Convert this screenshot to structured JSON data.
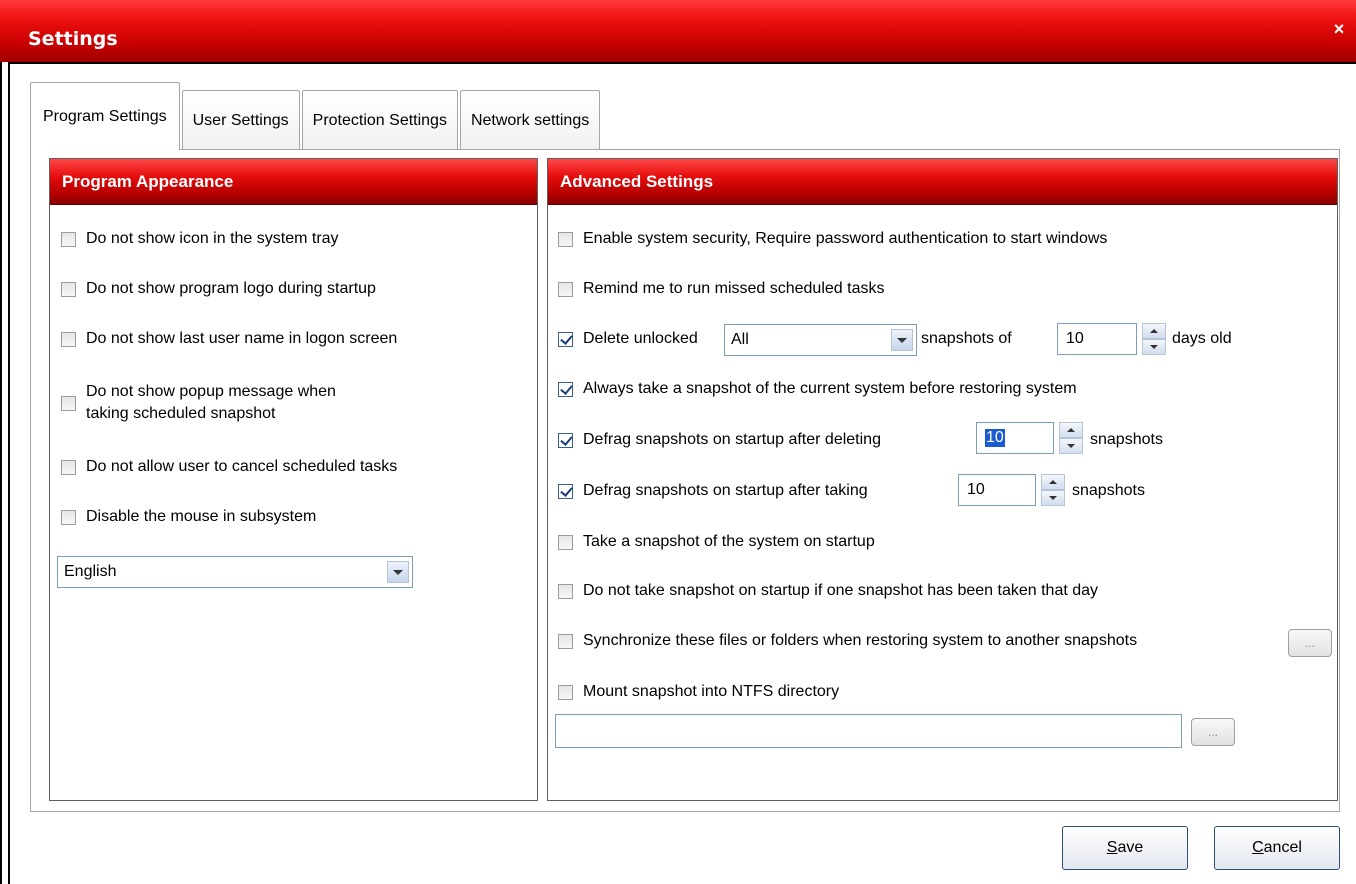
{
  "window": {
    "title": "Settings",
    "close_glyph": "×"
  },
  "tabs": [
    {
      "label": "Program Settings",
      "active": true
    },
    {
      "label": "User Settings",
      "active": false
    },
    {
      "label": "Protection Settings",
      "active": false
    },
    {
      "label": "Network settings",
      "active": false
    }
  ],
  "program_appearance": {
    "title": "Program Appearance",
    "options": [
      {
        "label": "Do not show icon in the system tray",
        "checked": false
      },
      {
        "label": "Do not show program logo during startup",
        "checked": false
      },
      {
        "label": "Do not show last user name in logon screen",
        "checked": false
      },
      {
        "label_line1": "Do not show popup message when",
        "label_line2": "taking scheduled snapshot",
        "checked": false
      },
      {
        "label": "Do not allow user to cancel scheduled tasks",
        "checked": false
      },
      {
        "label": "Disable the mouse in subsystem",
        "checked": false
      }
    ],
    "language": "English"
  },
  "advanced": {
    "title": "Advanced Settings",
    "enable_security": {
      "label": "Enable system security, Require password authentication to start windows",
      "checked": false
    },
    "remind_missed": {
      "label": "Remind me to run missed scheduled tasks",
      "checked": false
    },
    "delete_unlocked": {
      "label": "Delete unlocked",
      "checked": true,
      "select_value": "All",
      "mid_label": "snapshots of",
      "days": "10",
      "suffix": "days old"
    },
    "always_snapshot": {
      "label": "Always take a snapshot of the current system before restoring system",
      "checked": true
    },
    "defrag_deleting": {
      "label": "Defrag snapshots on startup after deleting",
      "checked": true,
      "value": "10",
      "suffix": "snapshots"
    },
    "defrag_taking": {
      "label": "Defrag snapshots on startup after taking",
      "checked": true,
      "value": "10",
      "suffix": "snapshots"
    },
    "snapshot_startup": {
      "label": "Take a snapshot of the system on startup",
      "checked": false
    },
    "no_snapshot_same_day": {
      "label": "Do not take snapshot on startup if one snapshot has been taken that day",
      "checked": false
    },
    "synchronize": {
      "label": "Synchronize these files or folders when restoring system to another snapshots",
      "checked": false,
      "button": "..."
    },
    "mount_ntfs": {
      "label": "Mount snapshot into NTFS directory",
      "checked": false,
      "path": "",
      "button": "..."
    }
  },
  "buttons": {
    "save_mnemonic": "S",
    "save_rest": "ave",
    "cancel_mnemonic": "C",
    "cancel_rest": "ancel"
  },
  "icons": [
    "close-icon",
    "dropdown-arrow-icon",
    "spinner-up-icon",
    "spinner-down-icon"
  ],
  "colors": {
    "title_red": "#e00000",
    "header_red": "#c80000",
    "selection_blue": "#1a5bd1"
  }
}
